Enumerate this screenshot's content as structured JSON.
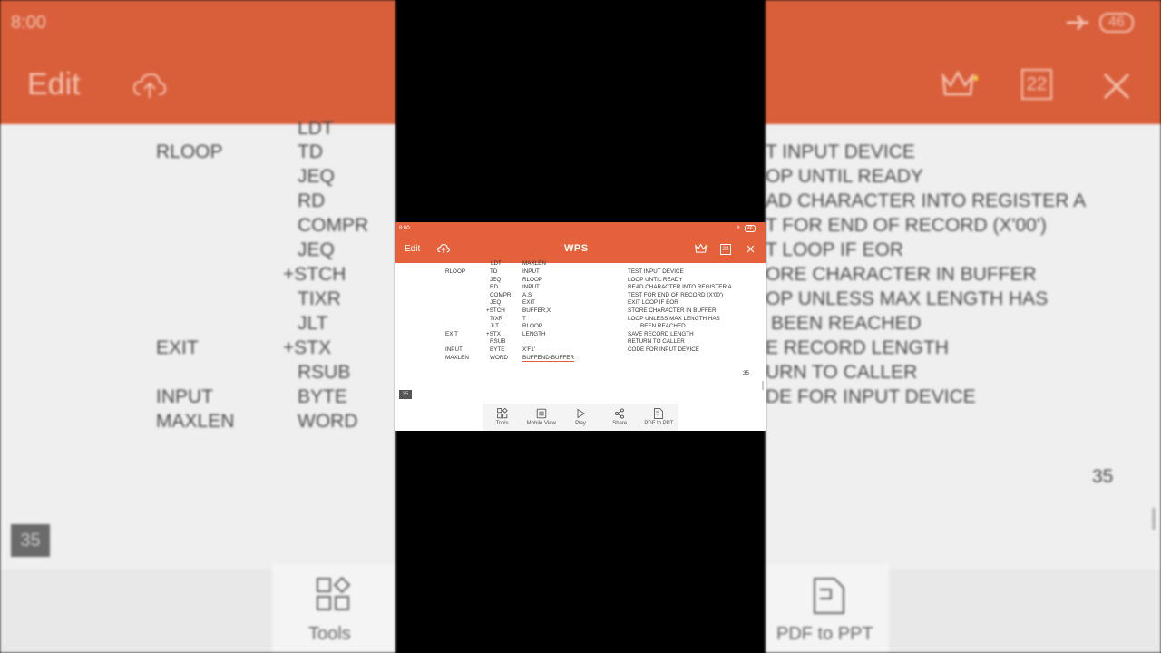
{
  "status_bar": {
    "time": "8:00",
    "battery": "46"
  },
  "toolbar": {
    "edit_label": "Edit",
    "logo": "WPS",
    "page_count": "22",
    "icons": [
      "cloud-upload-icon",
      "crown-icon",
      "page-count-icon",
      "close-icon"
    ]
  },
  "document": {
    "top_fragment": [
      "LDT",
      "MAXLEN"
    ],
    "rows": [
      {
        "label": "RLOOP",
        "op": "TD",
        "operand": "INPUT",
        "comment": "TEST INPUT DEVICE"
      },
      {
        "label": "",
        "op": "JEQ",
        "operand": "RLOOP",
        "comment": "LOOP UNTIL READY"
      },
      {
        "label": "",
        "op": "RD",
        "operand": "INPUT",
        "comment": "READ CHARACTER INTO REGISTER A"
      },
      {
        "label": "",
        "op": "COMPR",
        "operand": "A,S",
        "comment": "TEST FOR END OF RECORD (X'00')"
      },
      {
        "label": "",
        "op": "JEQ",
        "operand": "EXIT",
        "comment": "EXIT LOOP IF EOR"
      },
      {
        "label": "",
        "op": "+STCH",
        "operand": "BUFFER,X",
        "comment": "STORE CHARACTER IN BUFFER"
      },
      {
        "label": "",
        "op": "TIXR",
        "operand": "T",
        "comment": "LOOP UNLESS MAX LENGTH HAS"
      },
      {
        "label": "",
        "op": "JLT",
        "operand": "RLOOP",
        "comment": "BEEN REACHED"
      },
      {
        "label": "EXIT",
        "op": "+STX",
        "operand": "LENGTH",
        "comment": "SAVE RECORD LENGTH"
      },
      {
        "label": "",
        "op": "RSUB",
        "operand": "",
        "comment": "RETURN TO CALLER"
      },
      {
        "label": "INPUT",
        "op": "BYTE",
        "operand": "X'F1'",
        "comment": "CODE FOR INPUT DEVICE"
      },
      {
        "label": "MAXLEN",
        "op": "WORD",
        "operand": "BUFFEND-BUFFER",
        "comment": ""
      }
    ],
    "page_number": "35"
  },
  "page_badge": "35",
  "bottom_bar": [
    {
      "label": "Tools",
      "icon": "tools-icon"
    },
    {
      "label": "Mobile View",
      "icon": "mobile-view-icon"
    },
    {
      "label": "Play",
      "icon": "play-icon"
    },
    {
      "label": "Share",
      "icon": "share-icon"
    },
    {
      "label": "PDF to PPT",
      "icon": "pdf-to-ppt-icon"
    }
  ],
  "bg_left": {
    "labels": [
      "RLOOP",
      "EXIT",
      "INPUT",
      "MAXLEN"
    ],
    "ops": [
      "LDT",
      "TD",
      "JEQ",
      "RD",
      "COMPR",
      "JEQ",
      "+STCH",
      "TIXR",
      "JLT",
      "+STX",
      "RSUB",
      "BYTE",
      "WORD"
    ]
  },
  "bg_right": {
    "comments": [
      "T INPUT DEVICE",
      "OP UNTIL READY",
      "AD CHARACTER INTO REGISTER A",
      "T FOR END OF RECORD (X'00')",
      "T LOOP IF EOR",
      "ORE CHARACTER IN BUFFER",
      "OP UNLESS MAX LENGTH HAS",
      "BEEN REACHED",
      "E RECORD LENGTH",
      "URN TO CALLER",
      "DE FOR INPUT DEVICE"
    ],
    "page_number": "35",
    "bottom_label": "PDF to PPT"
  },
  "colors": {
    "accent": "#e5613b",
    "background": "#000000"
  }
}
